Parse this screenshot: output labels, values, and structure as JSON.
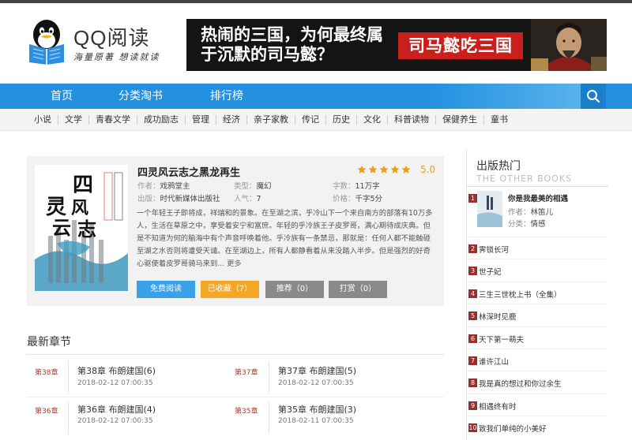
{
  "header": {
    "logo_title": "QQ阅读",
    "logo_slogan": "海量原著 想读就读",
    "banner_text": "热闹的三国，为何最终属于沉默的司马懿？",
    "banner_badge": "司马懿吃三国"
  },
  "nav": {
    "items": [
      "首页",
      "分类淘书",
      "排行榜"
    ]
  },
  "categories": [
    "小说",
    "文学",
    "青春文学",
    "成功励志",
    "管理",
    "经济",
    "亲子家教",
    "传记",
    "历史",
    "文化",
    "科普读物",
    "保健养生",
    "童书"
  ],
  "book": {
    "title": "四灵风云志之黑龙再生",
    "rating": "5.0",
    "stars": 5,
    "author_label": "作者：",
    "author": "戏鸦堂主",
    "type_label": "类型：",
    "type": "魔幻",
    "words_label": "字数：",
    "words": "11万字",
    "publisher_label": "出版：",
    "publisher": "时代新媒体出版社",
    "popularity_label": "人气：",
    "popularity": "7",
    "price_label": "价格：",
    "price": "千字5分",
    "description": "一个年轻王子即将成，祥瑞和的景象。在至湖之滨，乎冷山下一个来自南方的部落有10万多人，生活在草原之中，享受着安宁和富庶。年轻的乎冷族王子皮罗哥，满心期待成庆典。但是不知道为何的脑海中有个声音呼唤着他。乎冷族有一条禁忌，那就是：任何人都不能触碰至湖之水否则将遭受天谴。在至湖边上，所有人都静看着从来没踏入半步。但是强烈的好奇心驱使着皮罗哥骑马来到",
    "more": "... 更多",
    "buttons": {
      "read": "免费阅读",
      "collect": "已收藏（7）",
      "recommend": "推荐（0）",
      "reward": "打赏（0）"
    },
    "colors": {
      "read": "#3aa0e8",
      "collect": "#f5a623",
      "gray": "#8a8a8a"
    }
  },
  "latest": {
    "title": "最新章节",
    "chapters": [
      {
        "tag": "第38章",
        "name": "第38章  布朗建国(6)",
        "date": "2018-02-12  07:00:35"
      },
      {
        "tag": "第37章",
        "name": "第37章  布朗建国(5)",
        "date": "2018-02-12  07:00:35"
      },
      {
        "tag": "第36章",
        "name": "第36章  布朗建国(4)",
        "date": "2018-02-12  07:00:35"
      },
      {
        "tag": "第35章",
        "name": "第35章  布朗建国(3)",
        "date": "2018-02-11  07:00:35"
      }
    ]
  },
  "sidebar": {
    "title": "出版热门",
    "subtitle": "THE OTHER BOOKS",
    "first": {
      "no": "1",
      "name": "你是我最美的相遇",
      "author_label": "作者：",
      "author": "林笛儿",
      "cat_label": "分类：",
      "cat": "情感"
    },
    "items": [
      {
        "no": "2",
        "name": "霁锁长河"
      },
      {
        "no": "3",
        "name": "世子妃"
      },
      {
        "no": "4",
        "name": "三生三世枕上书（全集）"
      },
      {
        "no": "5",
        "name": "林深时见鹿"
      },
      {
        "no": "6",
        "name": "天下第一萌夫"
      },
      {
        "no": "7",
        "name": "谁许江山"
      },
      {
        "no": "8",
        "name": "我是真的想过和你过余生"
      },
      {
        "no": "9",
        "name": "相遇终有时"
      },
      {
        "no": "10",
        "name": "致我们单纯的小美好"
      }
    ]
  }
}
